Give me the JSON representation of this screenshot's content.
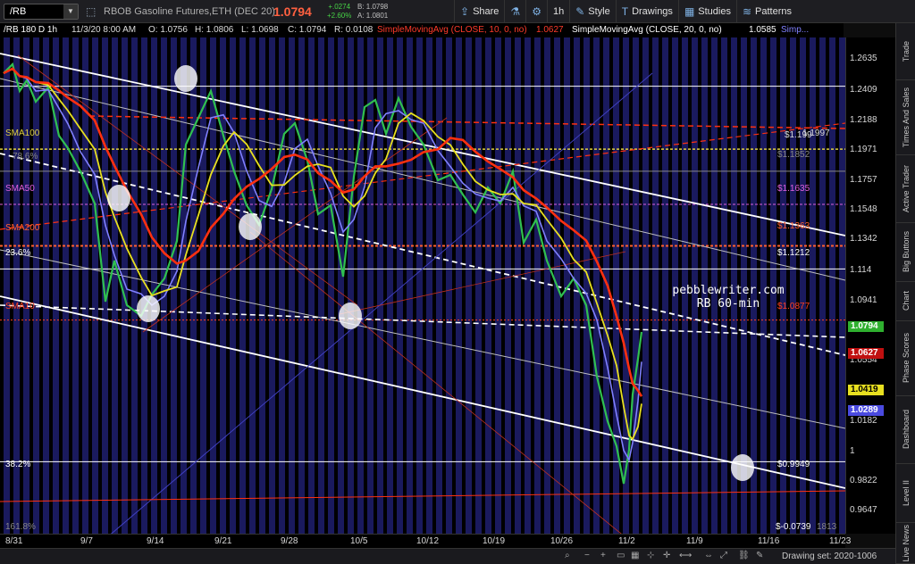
{
  "toolbar": {
    "symbol": "/RB",
    "instrument_name": "RBOB Gasoline Futures,ETH (DEC 20)",
    "last_price": "1.0794",
    "net_change": "+.0274",
    "pct_change": "+2.60%",
    "bid": "B: 1.0798",
    "ask": "A: 1.0801",
    "share_label": "Share",
    "timeframe_label": "1h",
    "style_label": "Style",
    "drawings_label": "Drawings",
    "studies_label": "Studies",
    "patterns_label": "Patterns"
  },
  "infoline": {
    "chart_label": "/RB 180 D 1h",
    "datetime": "11/3/20 8:00 AM",
    "open": "O: 1.0756",
    "high": "H: 1.0806",
    "low": "L: 1.0698",
    "close": "C: 1.0794",
    "range": "R: 0.0108",
    "sma10": "SimpleMovingAvg (CLOSE, 10, 0, no)",
    "sma10_val": "1.0627",
    "sma20": "SimpleMovingAvg (CLOSE, 20, 0, no)",
    "sma20_val": "1.0585",
    "sma_more": "Simp..."
  },
  "price_axis": {
    "ticks": [
      "1.2635",
      "1.2409",
      "1.2188",
      "1.1971",
      "1.1757",
      "1.1548",
      "1.1342",
      "1.114",
      "1.0941",
      "1.0746",
      "1.0554",
      "1.0366",
      "1.0182",
      "1",
      "0.9822",
      "0.9647"
    ],
    "badges": {
      "last": "1.0794",
      "sma10": "1.0627",
      "sma20": "1.0419",
      "sma50": "1.0289"
    }
  },
  "date_axis": {
    "ticks": [
      "8/31",
      "9/7",
      "9/14",
      "9/21",
      "9/28",
      "10/5",
      "10/12",
      "10/19",
      "10/26",
      "11/2",
      "11/9",
      "11/16",
      "11/23"
    ]
  },
  "annotations": {
    "sma100": "SMA100",
    "sma50": "SMA50",
    "sma200": "SMA200",
    "sma10": "SMA10",
    "fib786": "78.6%",
    "fib236": "23.6%",
    "fib382": "38.2%",
    "fib1618": "161.8%",
    "lvl_1199": "$1.199",
    "lvl_11997": "1.1997",
    "lvl_11852": "$1.1852",
    "lvl_11635": "$1.1635",
    "lvl_11363": "$1.1363",
    "lvl_11212": "$1.1212",
    "lvl_10877": "$1.0877",
    "lvl_09949": "$0.9949",
    "lvl_n00739": "$-0.0739",
    "lvl_1813": "1813",
    "watermark_site": "pebblewriter.com",
    "watermark_sub": "RB 60-min"
  },
  "sidebar": [
    "Trade",
    "Times And Sales",
    "Active Trader",
    "Big Buttons",
    "Chart",
    "Phase Scores",
    "Dashboard",
    "Level II",
    "Live News"
  ],
  "bottombar": {
    "drawing_set": "Drawing set: 2020-1006"
  },
  "colors": {
    "background": "#000000",
    "stripe": "#1e1e6e",
    "price_candle": "#30c050",
    "sma10": "#8080ff",
    "sma20": "#e8e020",
    "sma50": "#ff3010",
    "last_price": "#ff6040"
  }
}
